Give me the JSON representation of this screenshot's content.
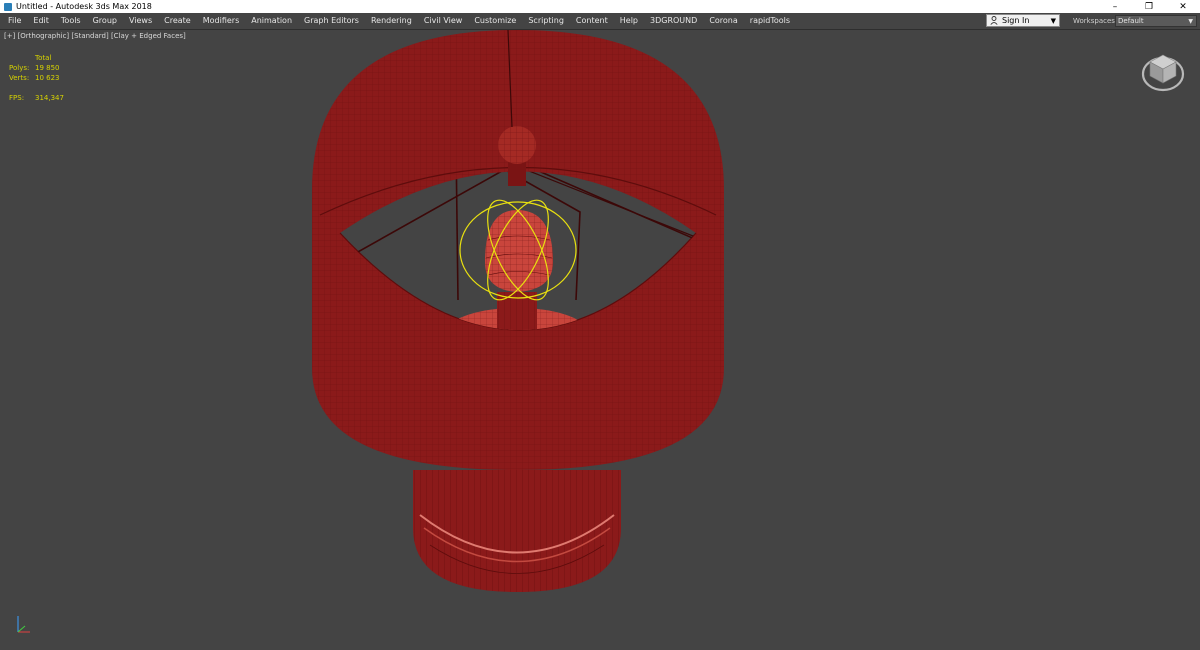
{
  "window": {
    "title": "Untitled - Autodesk 3ds Max 2018",
    "controls": [
      "–",
      "❐",
      "✕"
    ]
  },
  "menu": {
    "items": [
      "File",
      "Edit",
      "Tools",
      "Group",
      "Views",
      "Create",
      "Modifiers",
      "Animation",
      "Graph Editors",
      "Rendering",
      "Civil View",
      "Customize",
      "Scripting",
      "Content",
      "Help",
      "3DGROUND",
      "Corona",
      "rapidTools"
    ]
  },
  "account": {
    "signin_label": "Sign In"
  },
  "workspaces": {
    "label": "Workspaces:",
    "value": "Default"
  },
  "viewport": {
    "labels": [
      "[+]",
      "[Orthographic]",
      "[Standard]",
      "[Clay + Edged Faces]"
    ],
    "stats": {
      "header": "Total",
      "polys_label": "Polys:",
      "polys_value": "19 850",
      "verts_label": "Verts:",
      "verts_value": "10 623",
      "fps_label": "FPS:",
      "fps_value": "314,347"
    }
  },
  "colors": {
    "viewport_bg": "#444444",
    "model_red": "#8b1a1a",
    "wire": "#5e0c0c",
    "stats_yellow": "#d7d300",
    "selection_yellow": "#e8e010"
  }
}
